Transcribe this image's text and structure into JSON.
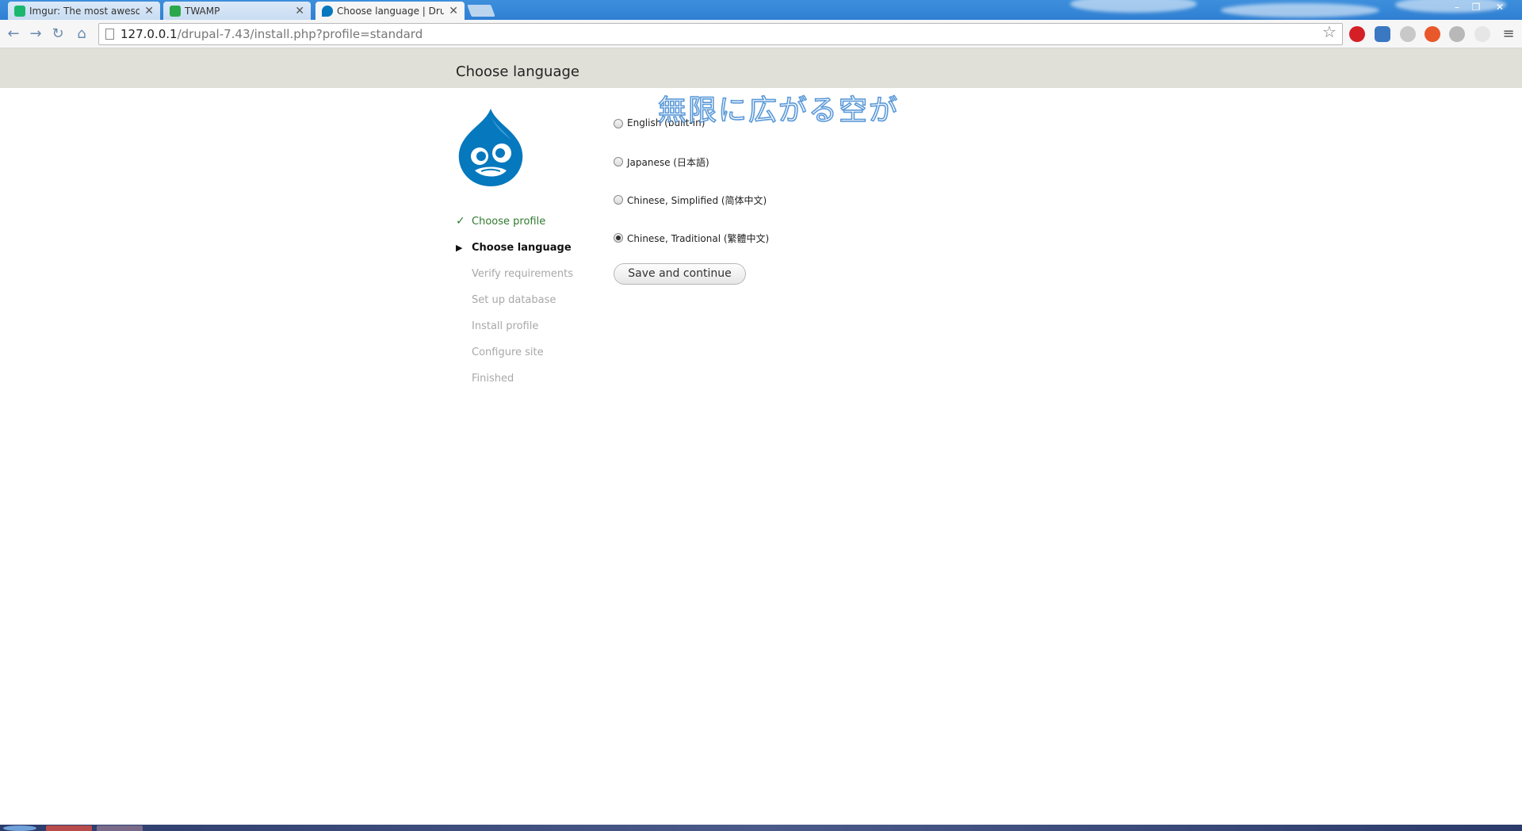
{
  "browser": {
    "tabs": [
      {
        "title": "Imgur: The most awesome",
        "favicon_color": "#1bb76e"
      },
      {
        "title": "TWAMP",
        "favicon_color": "#2ca84a"
      },
      {
        "title": "Choose language | Drupal",
        "favicon_color": "#0678be",
        "active": true
      }
    ],
    "tab_close_glyph": "✕",
    "address": {
      "host": "127.0.0.1",
      "path": "/drupal-7.43/install.php?profile=standard"
    },
    "extensions": [
      "adblock-plus-icon",
      "ghostery-icon",
      "search-extension-icon",
      "flame-extension-icon",
      "m-extension-icon"
    ]
  },
  "page": {
    "title": "Choose language",
    "overlay_text": "無限に広がる空が",
    "steps": [
      {
        "label": "Choose profile",
        "state": "done"
      },
      {
        "label": "Choose language",
        "state": "active"
      },
      {
        "label": "Verify requirements",
        "state": "pending"
      },
      {
        "label": "Set up database",
        "state": "pending"
      },
      {
        "label": "Install profile",
        "state": "pending"
      },
      {
        "label": "Configure site",
        "state": "pending"
      },
      {
        "label": "Finished",
        "state": "pending"
      }
    ],
    "languages": [
      {
        "label": "English (built-in)",
        "checked": false
      },
      {
        "label": "Japanese (日本語)",
        "checked": false
      },
      {
        "label": "Chinese, Simplified (简体中文)",
        "checked": false
      },
      {
        "label": "Chinese, Traditional (繁體中文)",
        "checked": true
      }
    ],
    "submit_label": "Save and continue"
  },
  "colors": {
    "header_band": "#e0e0d8",
    "drupal_blue": "#0678be",
    "done_green": "#2f7a2f",
    "pending_gray": "#a8a8a8"
  }
}
